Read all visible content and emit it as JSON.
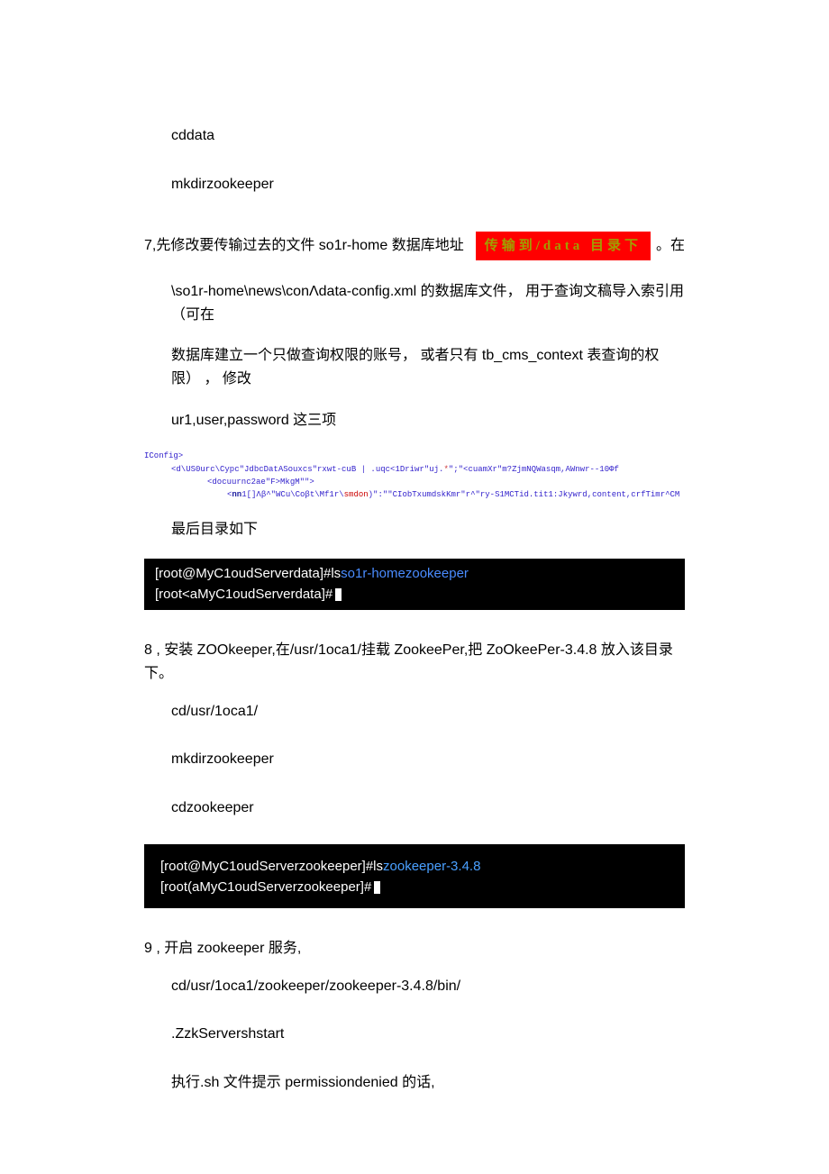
{
  "cddata": "cddata",
  "mkdir_zk1": "mkdirzookeeper",
  "step7": {
    "prefix": "7,先修改要传输过去的文件 so1r-home 数据库地址",
    "stamp": "传输到/data 目录下",
    "tail": "。在",
    "line2": "\\so1r-home\\news\\conΛdata-config.xml 的数据库文件， 用于查询文稿导入索引用 （可在",
    "line3": "数据库建立一个只做查询权限的账号， 或者只有 tb_cms_context 表查询的权限） ， 修改",
    "line4": "ur1,user,password 这三项"
  },
  "xml": {
    "l1": "IConfig>",
    "l2_a": "<d\\US0urc\\Cypc\"JdbcDatASouxcs\"rxwt-cuB | .uqc<1Driwr\"uj.",
    "l2_b": "*",
    "l2_c": "\";\"<cuamXr\"m?ZjmNQWasqm,AWnwr--10Φf",
    "l3": "<docuurnc2ae\"F>MkgM\"\">",
    "l4_a": "<",
    "l4_b": "nn",
    "l4_c": "1[]Λβ^\"WCu\\Coβt\\Mf1r\\",
    "l4_d": "smdon",
    "l4_e": ")\":\"\"CIobTxumdskKmr\"r^\"ry-S1MCTid.tit1:Jkywrd,content,crfTimr^CM"
  },
  "final_dir": "最后目录如下",
  "term1": {
    "l1_a": "[root@MyC1oudServerdata]#ls",
    "l1_b": "so1r-homezookeeper",
    "l2": "[root<aMyC1oudServerdata]#"
  },
  "step8": "8  , 安装 ZOOkeeper,在/usr/1oca1/挂载 ZookeePer,把 ZoOkeePer-3.4.8 放入该目录下。",
  "s8_cd": "cd/usr/1oca1/",
  "s8_mkdir": "mkdirzookeeper",
  "s8_cdzk": "cdzookeeper",
  "term2": {
    "l1_a": "[root@MyC1oudServerzookeeper]#ls",
    "l1_b": "zookeeper-3.4.8",
    "l2": "[root(aMyC1oudServerzookeeper]#"
  },
  "step9": "9  , 开启 zookeeper 服务,",
  "s9_cd": "cd/usr/1oca1/zookeeper/zookeeper-3.4.8/bin/",
  "s9_start": ".ZzkServershstart",
  "s9_note": "执行.sh 文件提示 permissiondenied 的话,"
}
